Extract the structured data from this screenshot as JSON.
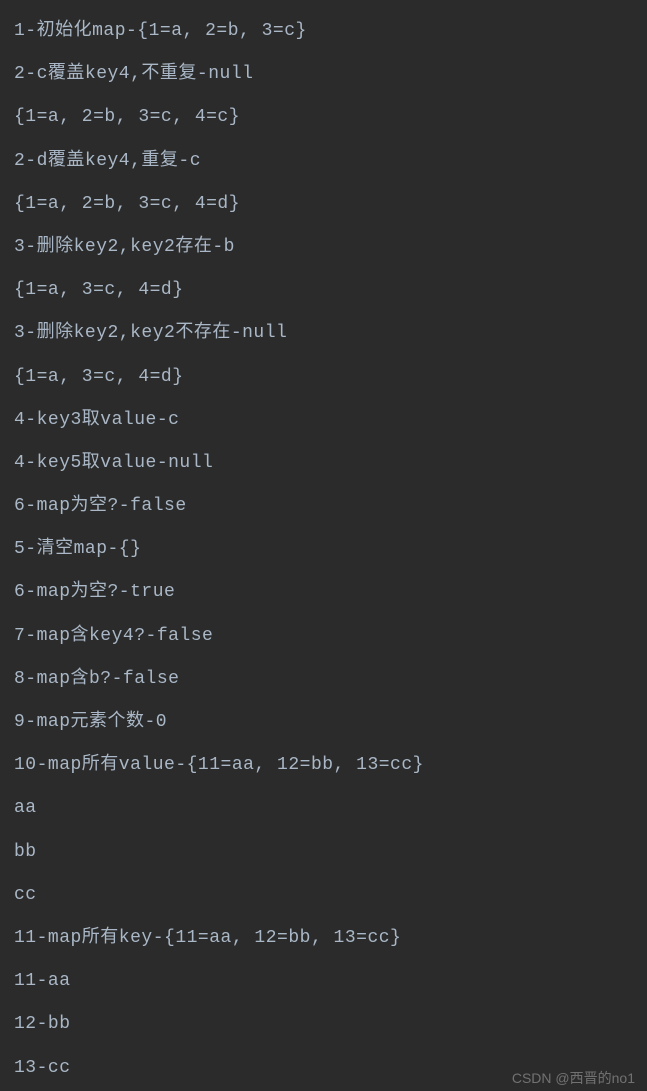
{
  "lines": [
    "1-初始化map-{1=a, 2=b, 3=c}",
    "2-c覆盖key4,不重复-null",
    "{1=a, 2=b, 3=c, 4=c}",
    "2-d覆盖key4,重复-c",
    "{1=a, 2=b, 3=c, 4=d}",
    "3-删除key2,key2存在-b",
    "{1=a, 3=c, 4=d}",
    "3-删除key2,key2不存在-null",
    "{1=a, 3=c, 4=d}",
    "4-key3取value-c",
    "4-key5取value-null",
    "6-map为空?-false",
    "5-清空map-{}",
    "6-map为空?-true",
    "7-map含key4?-false",
    "8-map含b?-false",
    "9-map元素个数-0",
    "10-map所有value-{11=aa, 12=bb, 13=cc}",
    "aa",
    "bb",
    "cc",
    "11-map所有key-{11=aa, 12=bb, 13=cc}",
    "11-aa",
    "12-bb",
    "13-cc"
  ],
  "watermark": "CSDN @西晋的no1"
}
